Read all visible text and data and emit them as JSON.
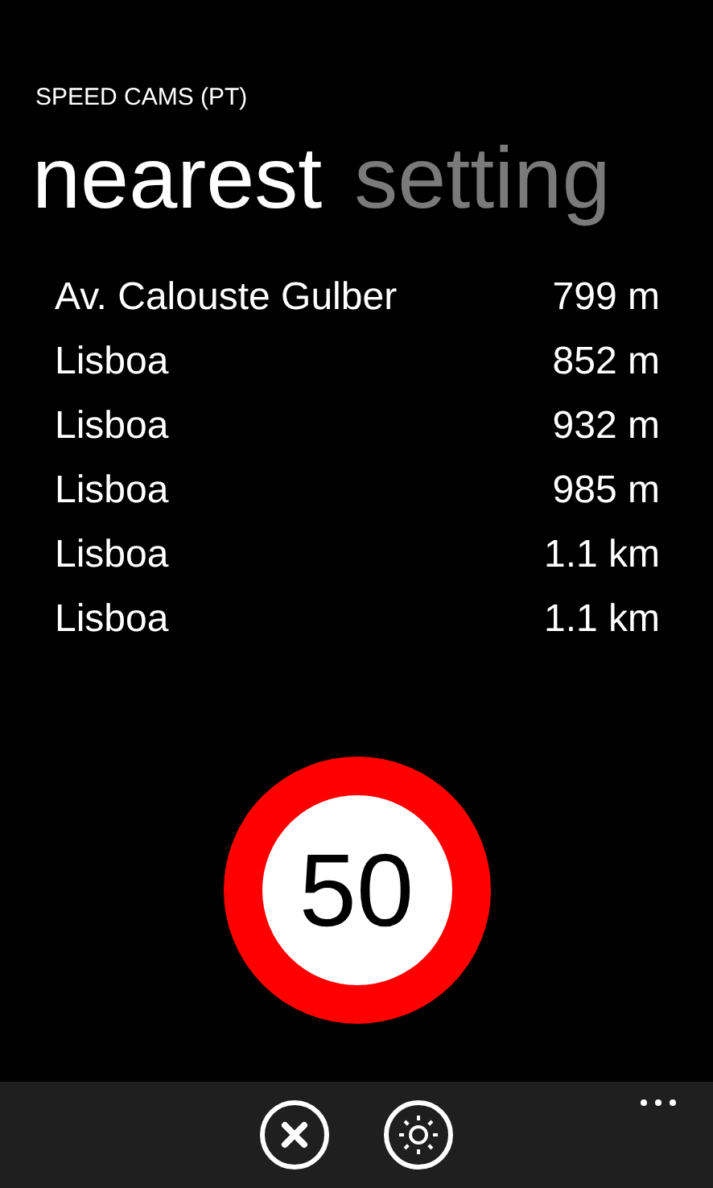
{
  "app_title": "SPEED CAMS (PT)",
  "pivots": [
    {
      "label": "nearest",
      "selected": true
    },
    {
      "label": "setting",
      "selected": false
    }
  ],
  "cameras": [
    {
      "name": "Av. Calouste Gulber",
      "distance": "799 m"
    },
    {
      "name": "Lisboa",
      "distance": "852 m"
    },
    {
      "name": "Lisboa",
      "distance": "932 m"
    },
    {
      "name": "Lisboa",
      "distance": "985 m"
    },
    {
      "name": "Lisboa",
      "distance": "1.1 km"
    },
    {
      "name": "Lisboa",
      "distance": "1.1 km"
    }
  ],
  "speed_limit": "50",
  "app_bar": {
    "buttons": [
      {
        "kind": "close"
      },
      {
        "kind": "brightness"
      }
    ]
  }
}
